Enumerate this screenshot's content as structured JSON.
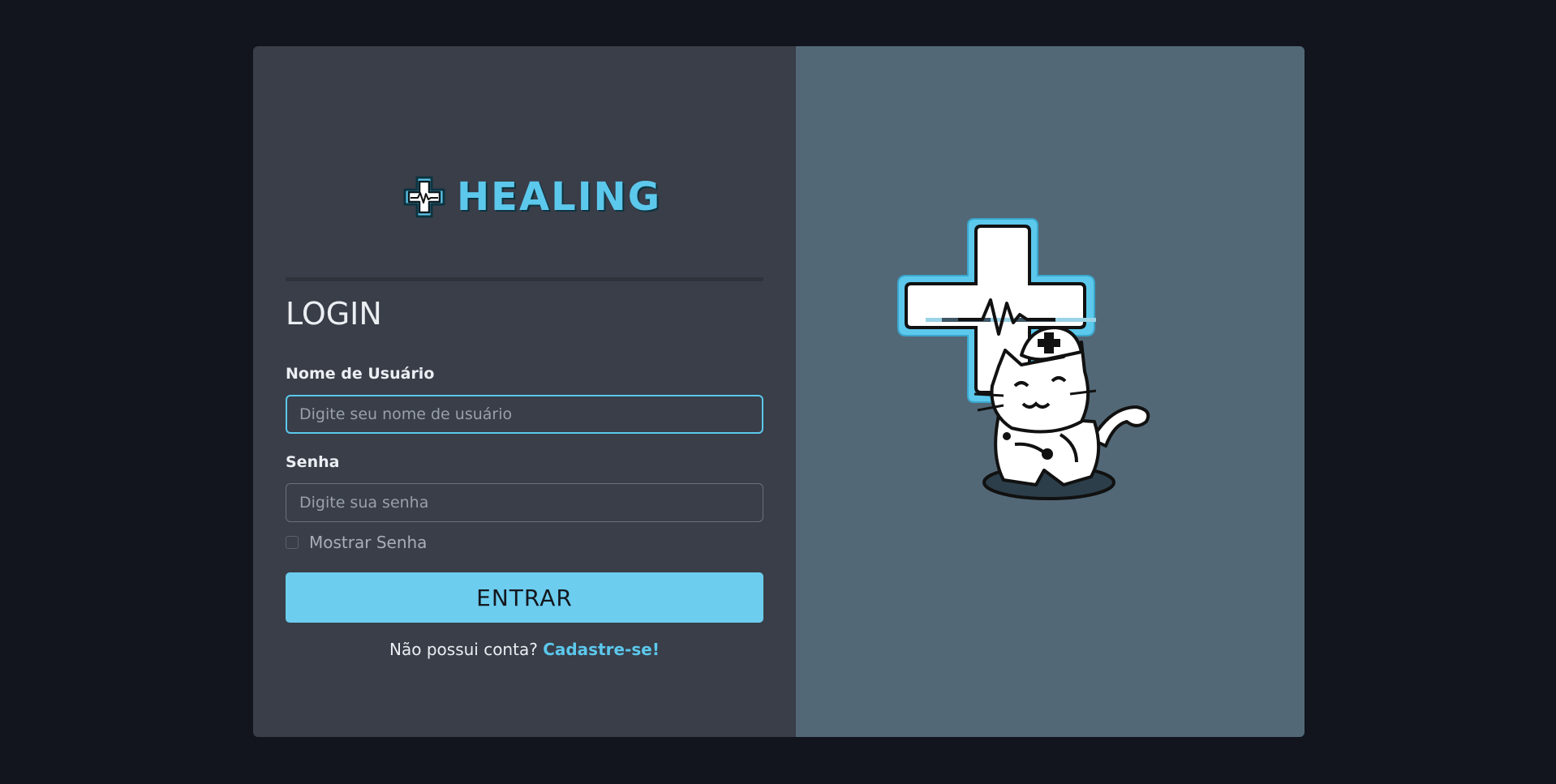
{
  "brand": {
    "name": "HEALING",
    "accent_color": "#5cc8ec",
    "logo_icon": "medical-cross-heartbeat-icon"
  },
  "login_form": {
    "title": "LOGIN",
    "username": {
      "label": "Nome de Usuário",
      "placeholder": "Digite seu nome de usuário",
      "value": ""
    },
    "password": {
      "label": "Senha",
      "placeholder": "Digite sua senha",
      "value": ""
    },
    "show_password": {
      "label": "Mostrar Senha",
      "checked": false
    },
    "submit_label": "ENTRAR",
    "signup_prompt": "Não possui conta?",
    "signup_link": "Cadastre-se!"
  },
  "illustration": {
    "icon": "nurse-cat-with-medical-cross-icon"
  },
  "colors": {
    "page_background": "#12151e",
    "form_panel": "#393e49",
    "illustration_panel": "#536877",
    "button": "#6ccdee"
  }
}
